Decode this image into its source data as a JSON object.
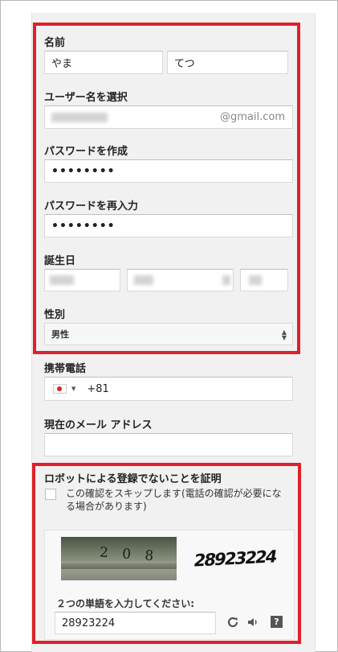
{
  "name": {
    "label": "名前",
    "last": "やま",
    "first": "てつ"
  },
  "username": {
    "label": "ユーザー名を選択",
    "suffix": "@gmail.com"
  },
  "create_password": {
    "label": "パスワードを作成",
    "value": "••••••••"
  },
  "confirm_password": {
    "label": "パスワードを再入力",
    "value": "••••••••"
  },
  "birthday": {
    "label": "誕生日"
  },
  "gender": {
    "label": "性別",
    "value": "男性"
  },
  "phone": {
    "label": "携帯電話",
    "country_code": "+81"
  },
  "email": {
    "label": "現在のメール アドレス",
    "value": ""
  },
  "robot": {
    "heading": "ロボットによる登録でないことを証明",
    "skip_line1": "この確認をスキップします(電話の確認が必要にな",
    "skip_line2": "る場合があります)",
    "captcha_photo_text": "2 0 8",
    "captcha_word_text": "28923224",
    "prompt": "２つの単語を入力してください:",
    "answer": "28923224"
  },
  "colors": {
    "highlight": "#e0202a",
    "card": "#f1f1f1"
  }
}
